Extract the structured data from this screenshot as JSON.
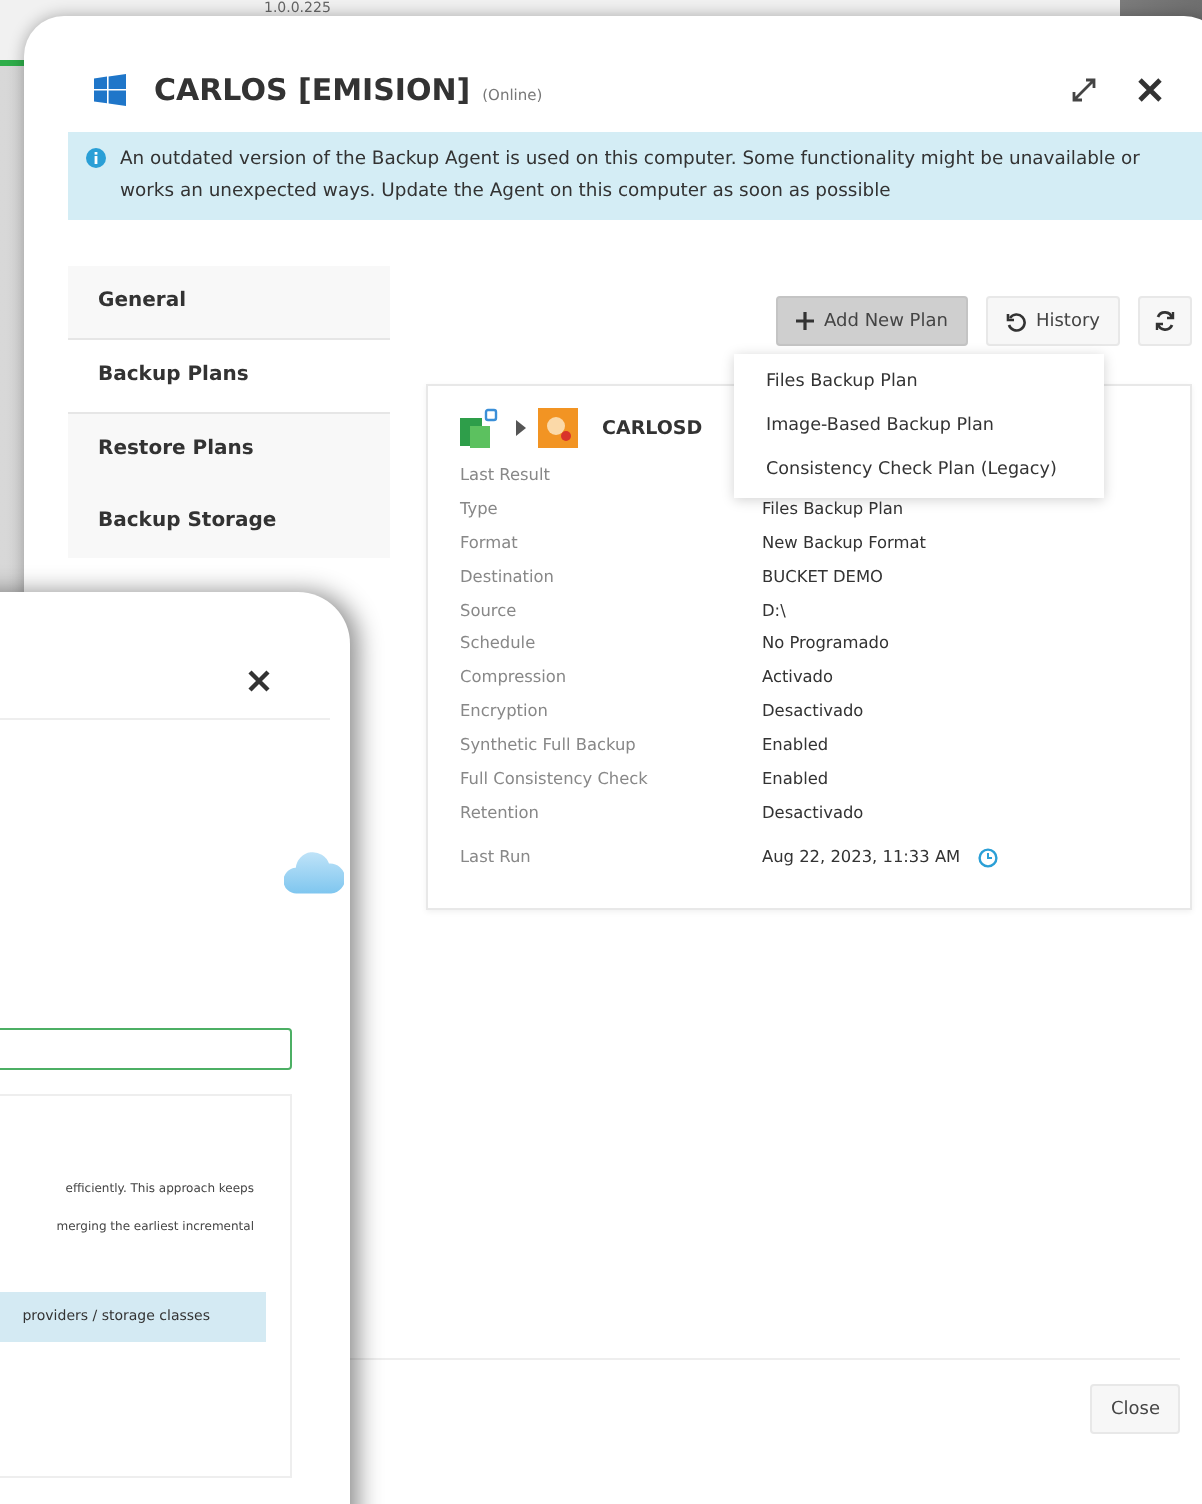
{
  "background": {
    "version_text": "1.0.0.225"
  },
  "window": {
    "title": "CARLOS [EMISION]",
    "status": "(Online)"
  },
  "alert": {
    "text": "An outdated version of the Backup Agent is used on this computer. Some functionality might be unavailable or works an unexpected ways. Update the Agent on this computer as soon as possible"
  },
  "sidebar": {
    "items": [
      {
        "label": "General",
        "selected": false
      },
      {
        "label": "Backup Plans",
        "selected": true
      },
      {
        "label": "Restore Plans",
        "selected": false
      },
      {
        "label": "Backup Storage",
        "selected": false
      }
    ]
  },
  "toolbar": {
    "add_button": "Add New Plan",
    "add_open": true,
    "history_button": "History"
  },
  "add_menu": {
    "items": [
      "Files Backup Plan",
      "Image-Based Backup Plan",
      "Consistency Check Plan (Legacy)"
    ]
  },
  "plan": {
    "name": "CARLOSD",
    "details": [
      {
        "label": "Last Result"
      },
      {
        "label": "Type",
        "value": "Files Backup Plan"
      },
      {
        "label": "Format",
        "value": "New Backup Format"
      },
      {
        "label": "Destination",
        "value": "BUCKET DEMO"
      },
      {
        "label": "Source",
        "value": "D:\\"
      },
      {
        "label": "Schedule",
        "value": "No Programado"
      },
      {
        "label": "Compression",
        "value": "Activado"
      },
      {
        "label": "Encryption",
        "value": "Desactivado"
      },
      {
        "label": "Synthetic Full Backup",
        "value": "Enabled"
      },
      {
        "label": "Full Consistency Check",
        "value": "Enabled"
      },
      {
        "label": "Retention",
        "value": "Desactivado"
      }
    ],
    "last_run": {
      "label": "Last Run",
      "value": "Aug 22, 2023, 11:33 AM"
    }
  },
  "footer": {
    "close_button": "Close"
  },
  "front_dialog": {
    "lines": [
      "efficiently. This approach keeps",
      "merging the earliest incremental"
    ],
    "highlight": "providers / storage classes"
  }
}
